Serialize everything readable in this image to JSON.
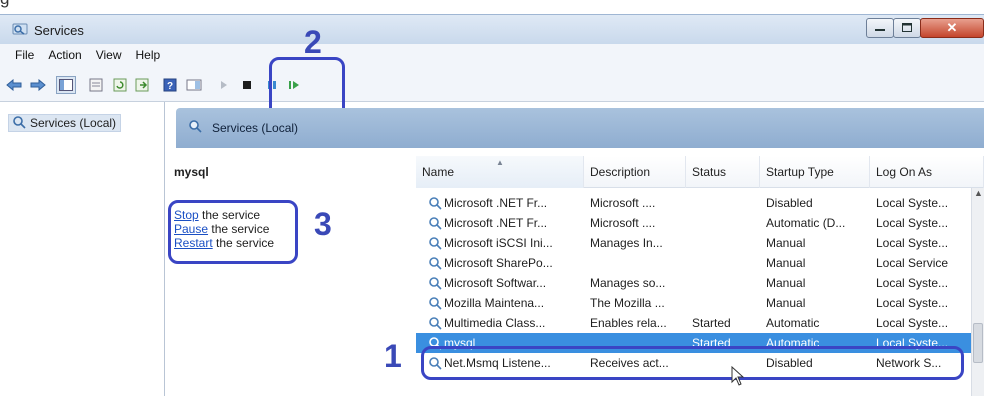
{
  "caption_fragment": "g",
  "window": {
    "title": "Services"
  },
  "menu": [
    "File",
    "Action",
    "View",
    "Help"
  ],
  "toolbar_icons": [
    "back-arrow-icon",
    "forward-arrow-icon",
    "console-tree-icon",
    "properties-icon",
    "refresh-icon",
    "export-list-icon",
    "help-icon",
    "show-hide-pane-icon",
    "start-service-icon",
    "stop-service-icon",
    "pause-service-icon",
    "restart-service-icon"
  ],
  "tree": {
    "root_label": "Services (Local)"
  },
  "pane": {
    "header_label": "Services (Local)"
  },
  "details": {
    "selected_service": "mysql",
    "actions": [
      {
        "link": "Stop",
        "rest": " the service"
      },
      {
        "link": "Pause",
        "rest": " the service"
      },
      {
        "link": "Restart",
        "rest": " the service"
      }
    ]
  },
  "annotations": {
    "one": "1",
    "two": "2",
    "three": "3"
  },
  "table": {
    "columns": [
      "Name",
      "Description",
      "Status",
      "Startup Type",
      "Log On As"
    ],
    "rows": [
      {
        "name": "Microsoft .NET Fr...",
        "description": "Microsoft ....",
        "status": "",
        "startup": "Disabled",
        "logon": "Local Syste..."
      },
      {
        "name": "Microsoft .NET Fr...",
        "description": "Microsoft ....",
        "status": "",
        "startup": "Automatic (D...",
        "logon": "Local Syste..."
      },
      {
        "name": "Microsoft iSCSI Ini...",
        "description": "Manages In...",
        "status": "",
        "startup": "Manual",
        "logon": "Local Syste..."
      },
      {
        "name": "Microsoft SharePo...",
        "description": "",
        "status": "",
        "startup": "Manual",
        "logon": "Local Service"
      },
      {
        "name": "Microsoft Softwar...",
        "description": "Manages so...",
        "status": "",
        "startup": "Manual",
        "logon": "Local Syste..."
      },
      {
        "name": "Mozilla Maintena...",
        "description": "The Mozilla ...",
        "status": "",
        "startup": "Manual",
        "logon": "Local Syste..."
      },
      {
        "name": "Multimedia Class...",
        "description": "Enables rela...",
        "status": "Started",
        "startup": "Automatic",
        "logon": "Local Syste..."
      },
      {
        "name": "mysql",
        "description": "",
        "status": "Started",
        "startup": "Automatic",
        "logon": "Local Syste...",
        "selected": true
      },
      {
        "name": "Net.Msmq Listene...",
        "description": "Receives act...",
        "status": "",
        "startup": "Disabled",
        "logon": "Network S..."
      }
    ]
  },
  "colors": {
    "annotation": "#3a45c4",
    "selection": "#3a8fe0",
    "link": "#1a4fc4"
  }
}
